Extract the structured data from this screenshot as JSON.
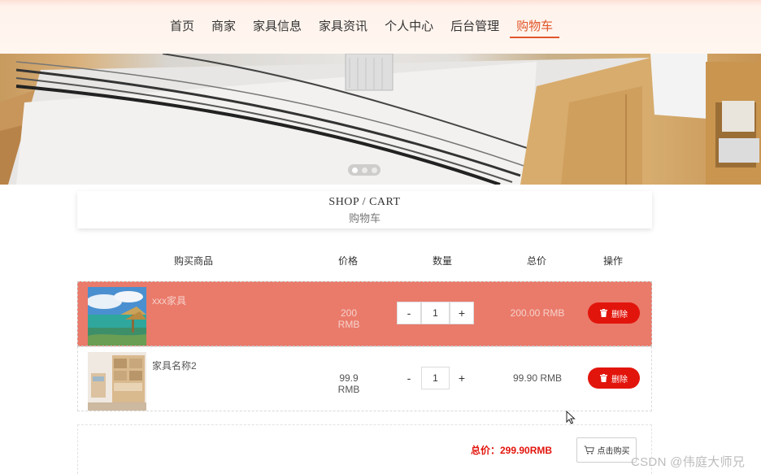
{
  "nav": {
    "items": [
      {
        "label": "首页"
      },
      {
        "label": "商家"
      },
      {
        "label": "家具信息"
      },
      {
        "label": "家具资讯"
      },
      {
        "label": "个人中心"
      },
      {
        "label": "后台管理"
      },
      {
        "label": "购物车"
      }
    ],
    "active_index": 6
  },
  "banner": {
    "slides": 3,
    "active_slide": 0
  },
  "section": {
    "title_en": "SHOP / CART",
    "title_cn": "购物车"
  },
  "table": {
    "headers": {
      "product": "购买商品",
      "price": "价格",
      "quantity": "数量",
      "total": "总价",
      "action": "操作"
    },
    "rows": [
      {
        "name": "xxx家具",
        "price": "200 RMB",
        "qty_minus": "-",
        "qty": "1",
        "qty_plus": "+",
        "total": "200.00 RMB",
        "delete": "删除",
        "selected": true
      },
      {
        "name": "家具名称2",
        "price": "99.9 RMB",
        "qty_minus": "-",
        "qty": "1",
        "qty_plus": "+",
        "total": "99.90 RMB",
        "delete": "删除",
        "selected": false
      }
    ]
  },
  "summary": {
    "total_label": "总价：299.90RMB",
    "buy_label": "点击购买"
  },
  "watermark": "CSDN @伟庭大师兄",
  "colors": {
    "accent": "#e0562b",
    "danger": "#e2150c",
    "selected_row": "#ea7a6a",
    "nav_bg": "#fff6f0"
  }
}
